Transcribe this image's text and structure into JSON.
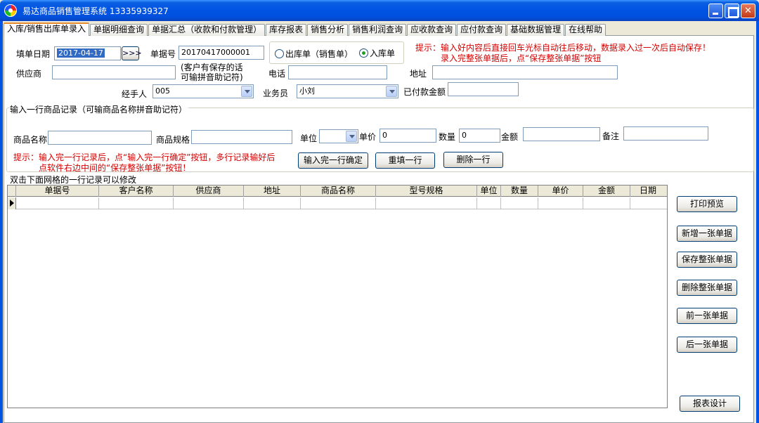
{
  "window": {
    "title": "易达商品销售管理系统 13335939327"
  },
  "tabs": [
    "入库/销售出库单录入",
    "单据明细查询",
    "单据汇总（收款和付款管理）",
    "库存报表",
    "销售分析",
    "销售利润查询",
    "应收款查询",
    "应付款查询",
    "基础数据管理",
    "在线帮助"
  ],
  "form": {
    "date_label": "填单日期",
    "date_value": "2017-04-17",
    "date_btn": ">>>",
    "docno_label": "单据号",
    "docno_value": "20170417000001",
    "radio_out": "出库单（销售单）",
    "radio_in": "入库单",
    "selected_radio": "入库单",
    "supplier_label": "供应商",
    "supplier_value": "",
    "supplier_note": "(客户有保存的话\n可输拼音助记符)",
    "phone_label": "电话",
    "phone_value": "",
    "address_label": "地址",
    "address_value": "",
    "handler_label": "经手人",
    "handler_value": "005",
    "salesman_label": "业务员",
    "salesman_value": "小刘",
    "paid_label": "已付款金额",
    "paid_value": "",
    "tip_title": "提示：",
    "tip_line1": "输入好内容后直接回车光标自动往后移动，数据录入过一次后自动保存！",
    "tip_line2": "录入完整张单据后，点“保存整张单据”按钮"
  },
  "line_entry": {
    "group_title": "输入一行商品记录（可输商品名称拼音助记符）",
    "name_label": "商品名称",
    "spec_label": "商品规格",
    "unit_label": "单位",
    "price_label": "单价",
    "price_value": "0",
    "qty_label": "数量",
    "qty_value": "0",
    "amount_label": "金额",
    "amount_value": "",
    "remark_label": "备注",
    "remark_value": "",
    "tip_title": "提示：",
    "tip_line1": "输入完一行记录后，点“输入完一行确定”按钮，多行记录输好后",
    "tip_line2": "点软件右边中间的“保存整张单据”按钮！",
    "confirm_btn": "输入完一行确定",
    "reset_btn": "重填一行",
    "delete_btn": "删除一行"
  },
  "grid": {
    "title": "双击下面网格的一行记录可以修改",
    "columns": [
      "单据号",
      "客户名称",
      "供应商",
      "地址",
      "商品名称",
      "型号规格",
      "单位",
      "数量",
      "单价",
      "金额",
      "日期"
    ]
  },
  "side_buttons": {
    "print_preview": "打印预览",
    "new_doc": "新增一张单据",
    "save_doc": "保存整张单据",
    "delete_doc": "删除整张单据",
    "prev_doc": "前一张单据",
    "next_doc": "后一张单据",
    "report_design": "报表设计"
  }
}
